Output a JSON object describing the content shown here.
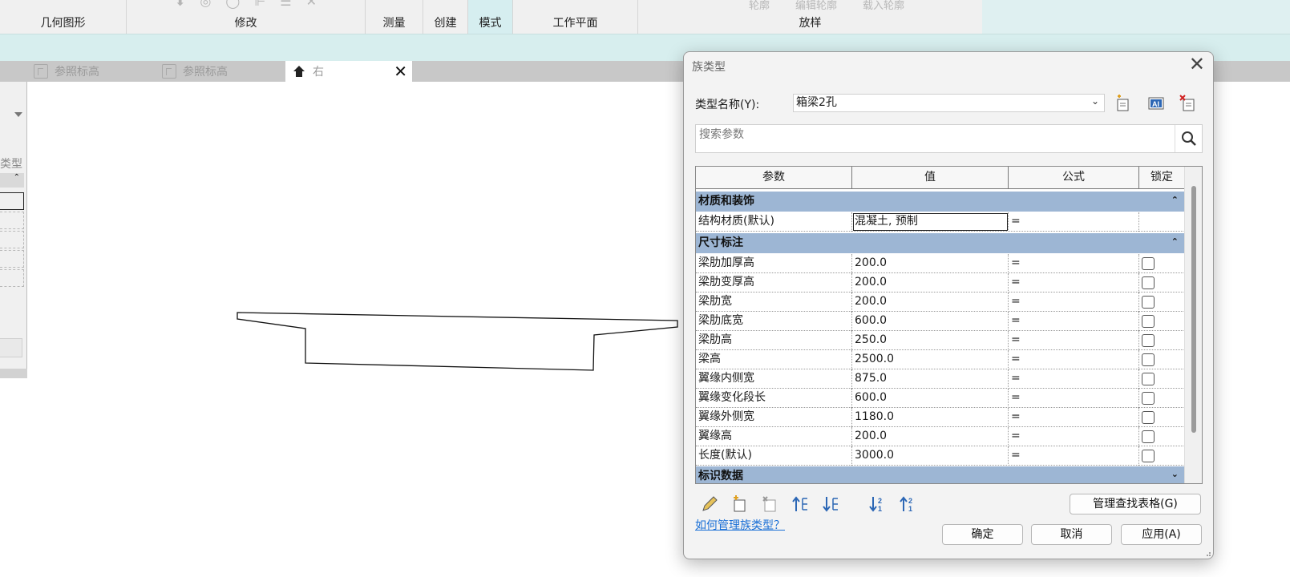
{
  "ribbon": {
    "groups": [
      "几何图形",
      "修改",
      "测量",
      "创建",
      "模式",
      "工作平面",
      "放样"
    ],
    "faded": [
      "轮廓",
      "编辑轮廓",
      "载入轮廓"
    ]
  },
  "view_tabs": [
    {
      "label": "参照标高",
      "active": false
    },
    {
      "label": "参照标高",
      "active": false
    },
    {
      "label": "右",
      "active": true
    }
  ],
  "left_panel": {
    "label": "类型"
  },
  "dialog": {
    "title": "族类型",
    "type_name_label": "类型名称(Y):",
    "type_name_value": "箱梁2孔",
    "search_placeholder": "搜索参数",
    "columns": [
      "参数",
      "值",
      "公式",
      "锁定"
    ],
    "group_material": "材质和装饰",
    "group_dimensions": "尺寸标注",
    "group_identity": "标识数据",
    "material_row": {
      "param": "结构材质(默认)",
      "value": "混凝土, 预制",
      "formula": "="
    },
    "dim_rows": [
      {
        "param": "梁肋加厚高",
        "value": "200.0",
        "formula": "="
      },
      {
        "param": "梁肋变厚高",
        "value": "200.0",
        "formula": "="
      },
      {
        "param": "梁肋宽",
        "value": "200.0",
        "formula": "="
      },
      {
        "param": "梁肋底宽",
        "value": "600.0",
        "formula": "="
      },
      {
        "param": "梁肋高",
        "value": "250.0",
        "formula": "="
      },
      {
        "param": "梁高",
        "value": "2500.0",
        "formula": "="
      },
      {
        "param": "翼缘内侧宽",
        "value": "875.0",
        "formula": "="
      },
      {
        "param": "翼缘变化段长",
        "value": "600.0",
        "formula": "="
      },
      {
        "param": "翼缘外侧宽",
        "value": "1180.0",
        "formula": "="
      },
      {
        "param": "翼缘高",
        "value": "200.0",
        "formula": "="
      },
      {
        "param": "长度(默认)",
        "value": "3000.0",
        "formula": "="
      }
    ],
    "manage_lookup": "管理查找表格(G)",
    "help_link": "如何管理族类型？",
    "ok": "确定",
    "cancel": "取消",
    "apply": "应用(A)"
  },
  "colors": {
    "group_header": "#9db6d4",
    "ribbon_bg": "#dff0f1",
    "link": "#1a6fd6"
  }
}
